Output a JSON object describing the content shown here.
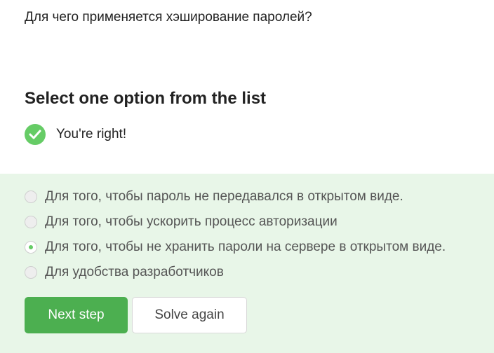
{
  "question": {
    "text": "Для чего применяется хэширование паролей?"
  },
  "step": {
    "title": "Select one option from the list",
    "feedback": {
      "text": "You're right!",
      "icon": "checkmark-icon",
      "color": "#66cc66"
    }
  },
  "options": [
    {
      "label": "Для того, чтобы пароль не передавался в открытом виде.",
      "selected": false
    },
    {
      "label": "Для того, чтобы ускорить процесс авторизации",
      "selected": false
    },
    {
      "label": "Для того, чтобы не хранить пароли на сервере в открытом виде.",
      "selected": true
    },
    {
      "label": "Для удобства разработчиков",
      "selected": false
    }
  ],
  "actions": {
    "next_label": "Next step",
    "solve_again_label": "Solve again"
  },
  "colors": {
    "accent": "#4caf50",
    "correct_background": "#e8f6e8"
  }
}
